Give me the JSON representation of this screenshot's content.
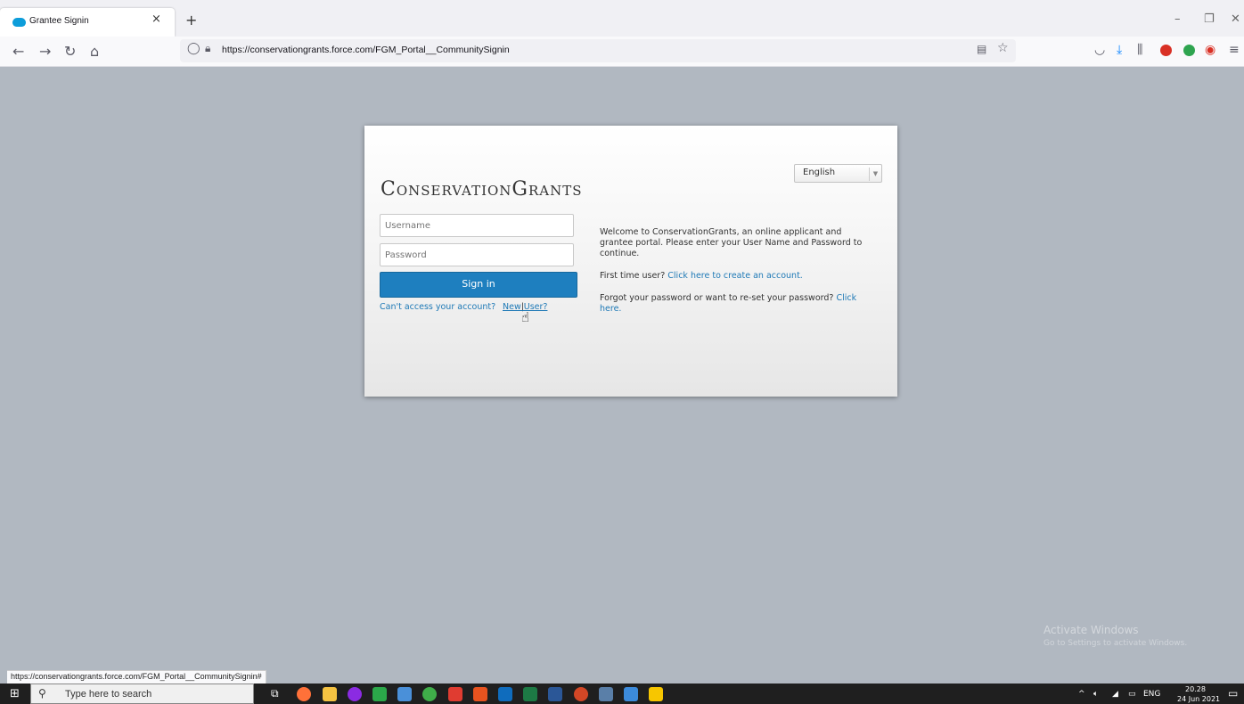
{
  "browser": {
    "tab_title": "Grantee Signin",
    "tab_close": "×",
    "new_tab": "+",
    "url": "https://conservationgrants.force.com/FGM_Portal__CommunitySignin",
    "status_url": "https://conservationgrants.force.com/FGM_Portal__CommunitySignin#"
  },
  "login": {
    "language": "English",
    "logo": "ConservationGrants",
    "username_placeholder": "Username",
    "password_placeholder": "Password",
    "sign_in": "Sign in",
    "cant_access": "Can't access your account?",
    "separator": "|",
    "new_user": "New User?"
  },
  "info": {
    "welcome": "Welcome to ConservationGrants, an online applicant and grantee portal. Please enter your User Name and Password to continue.",
    "first_time_prefix": "First time user? ",
    "first_time_link": "Click here to create an account.",
    "forgot_prefix": "Forgot your password or want to re-set your password? ",
    "forgot_link": "Click here."
  },
  "windows": {
    "search_placeholder": "Type here to search",
    "language": "ENG",
    "time": "20.28",
    "date": "24 Jun 2021",
    "watermark_title": "Activate Windows",
    "watermark_sub": "Go to Settings to activate Windows."
  },
  "colors": {
    "page_bg": "#b1b8c1",
    "button_bg": "#1e7fbf",
    "link": "#1e79b6"
  }
}
